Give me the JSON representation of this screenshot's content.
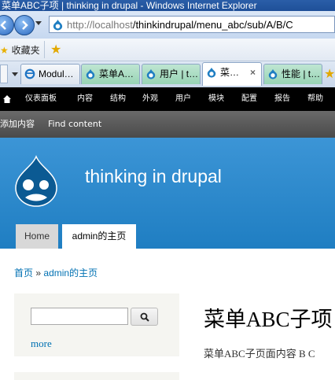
{
  "window": {
    "title": "菜单ABC子项 | thinking in drupal - Windows Internet Explorer"
  },
  "address": {
    "host": "http://localhost",
    "path": "/thinkindrupal/menu_abc/sub/A/B/C"
  },
  "favorites": {
    "label": "收藏夹"
  },
  "tabs": [
    {
      "label": "Modul…"
    },
    {
      "label": "菜单A…"
    },
    {
      "label": "用户 | t…"
    },
    {
      "label": "菜…"
    },
    {
      "label": "性能 | t…"
    }
  ],
  "toolbar": {
    "items": [
      "仪表面板",
      "内容",
      "结构",
      "外观",
      "用户",
      "模块",
      "配置",
      "报告",
      "帮助"
    ]
  },
  "shortcuts": {
    "add_content": "添加内容",
    "find_content": "Find content"
  },
  "site": {
    "name": "thinking in drupal"
  },
  "nav": {
    "home": "Home",
    "admin": "admin的主页"
  },
  "breadcrumb": {
    "home": "首页",
    "sep": "»",
    "current": "admin的主页"
  },
  "sidebar": {
    "more": "more"
  },
  "page": {
    "title": "菜单ABC子项",
    "body": "菜单ABC子页面内容 B C"
  },
  "colors": {
    "header": "#2b88cb",
    "link": "#0071b3",
    "toolbar": "#000000"
  }
}
